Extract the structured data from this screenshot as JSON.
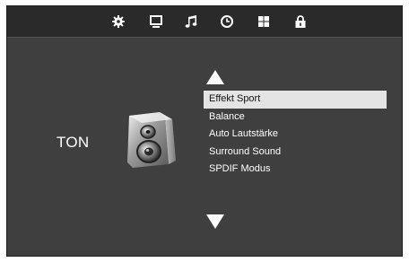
{
  "screen": {
    "section_title": "TON",
    "section_icon": "speaker-icon"
  },
  "topbar": {
    "icons": [
      "gear-icon",
      "monitor-icon",
      "music-note-icon",
      "clock-icon",
      "grid-icon",
      "lock-icon"
    ],
    "active_icon": "music-note-icon"
  },
  "menu": {
    "up_arrow": "triangle-up-icon",
    "down_arrow": "triangle-down-icon",
    "selected_index": 0,
    "items": [
      {
        "label": "Effekt Sport"
      },
      {
        "label": "Balance"
      },
      {
        "label": "Auto Lautstärke"
      },
      {
        "label": "Surround Sound"
      },
      {
        "label": "SPDIF Modus"
      }
    ]
  },
  "colors": {
    "background": "#3f3f3f",
    "topbar": "#2a2a2a",
    "highlight": "#e4e4e4",
    "text": "#ffffff"
  }
}
